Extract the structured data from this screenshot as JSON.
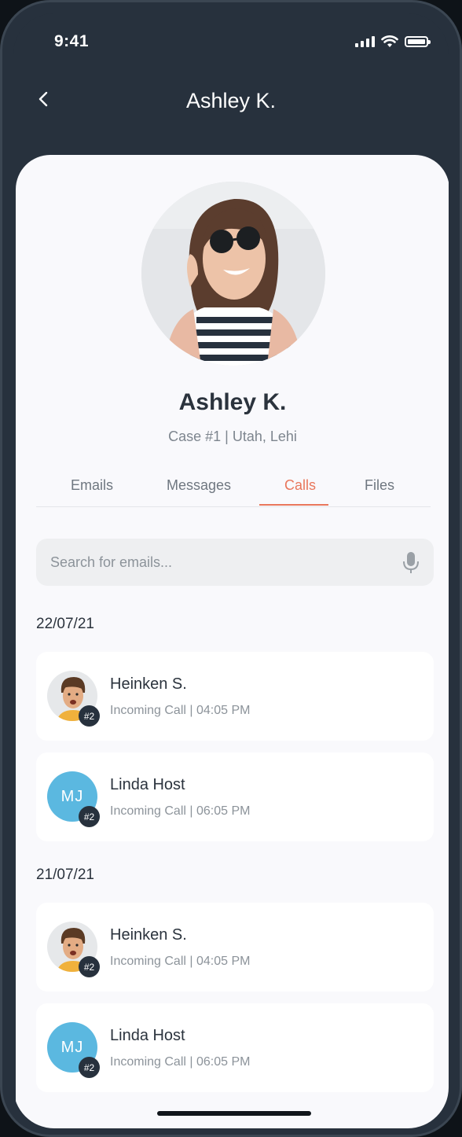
{
  "status": {
    "time": "9:41"
  },
  "header": {
    "title": "Ashley K."
  },
  "profile": {
    "name": "Ashley K.",
    "subtitle": "Case #1 | Utah, Lehi"
  },
  "tabs": [
    {
      "label": "Emails"
    },
    {
      "label": "Messages"
    },
    {
      "label": "Calls",
      "active": true
    },
    {
      "label": "Files"
    }
  ],
  "search": {
    "placeholder": "Search for emails..."
  },
  "groups": [
    {
      "date": "22/07/21",
      "items": [
        {
          "name": "Heinken S.",
          "detail": "Incoming Call | 04:05 PM",
          "badge": "#2",
          "avatar": "photo"
        },
        {
          "name": "Linda Host",
          "detail": "Incoming Call | 06:05 PM",
          "badge": "#2",
          "initials": "MJ"
        }
      ]
    },
    {
      "date": "21/07/21",
      "items": [
        {
          "name": "Heinken S.",
          "detail": "Incoming Call | 04:05 PM",
          "badge": "#2",
          "avatar": "photo"
        },
        {
          "name": "Linda Host",
          "detail": "Incoming Call | 06:05 PM",
          "badge": "#2",
          "initials": "MJ"
        }
      ]
    }
  ],
  "colors": {
    "accent": "#e9775c",
    "initials_bg": "#5bb8e0",
    "header_bg": "#27313d"
  }
}
